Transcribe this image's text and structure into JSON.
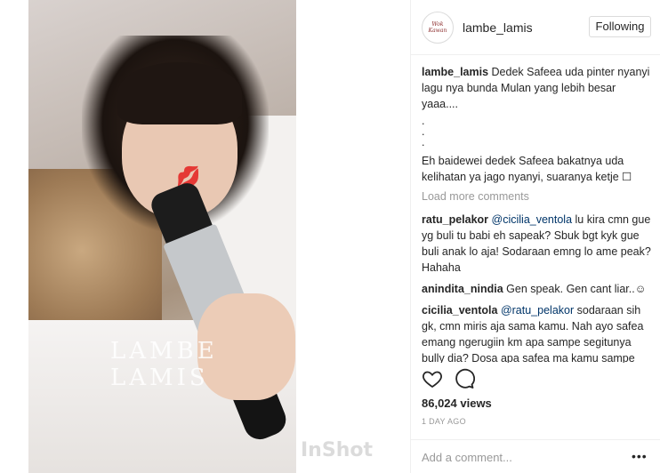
{
  "media": {
    "watermark": "LAMBE LAMIS",
    "app_watermark": "InShot"
  },
  "header": {
    "avatar_text": "Wok Kawan",
    "username": "lambe_lamis",
    "follow_label": "Following"
  },
  "caption": {
    "user": "lambe_lamis",
    "text": "Dedek Safeea uda pinter nyanyi lagu nya bunda Mulan yang lebih besar yaaa....",
    "dots": ".\n.\n.",
    "text2": "Eh baidewei dedek Safeea bakatnya uda kelihatan ya jago nyanyi, suaranya ketje ☐"
  },
  "load_more_label": "Load more comments",
  "comments": [
    {
      "user": "ratu_pelakor",
      "mention": "@cicilia_ventola",
      "text": "lu kira cmn gue yg buli tu babi eh sapeak? Sbuk bgt kyk gue buli anak lo aja! Sodaraan emng lo ame peak? Hahaha"
    },
    {
      "user": "anindita_nindia",
      "mention": "",
      "text": "Gen speak. Gen cant liar..☺"
    },
    {
      "user": "cicilia_ventola",
      "mention": "@ratu_pelakor",
      "text": "sodaraan sih gk, cmn miris aja sama kamu. Nah ayo safea emang ngerugiin km apa sampe segitunya bully dia? Dosa apa safea ma kamu sampe ngebabi-in dia? Ckckck"
    }
  ],
  "stats": {
    "views": "86,024 views",
    "timestamp": "1 DAY AGO"
  },
  "add_comment": {
    "placeholder": "Add a comment..."
  },
  "icons": {
    "like": "heart-icon",
    "comment": "comment-bubble-icon",
    "more": "more-options-icon"
  }
}
